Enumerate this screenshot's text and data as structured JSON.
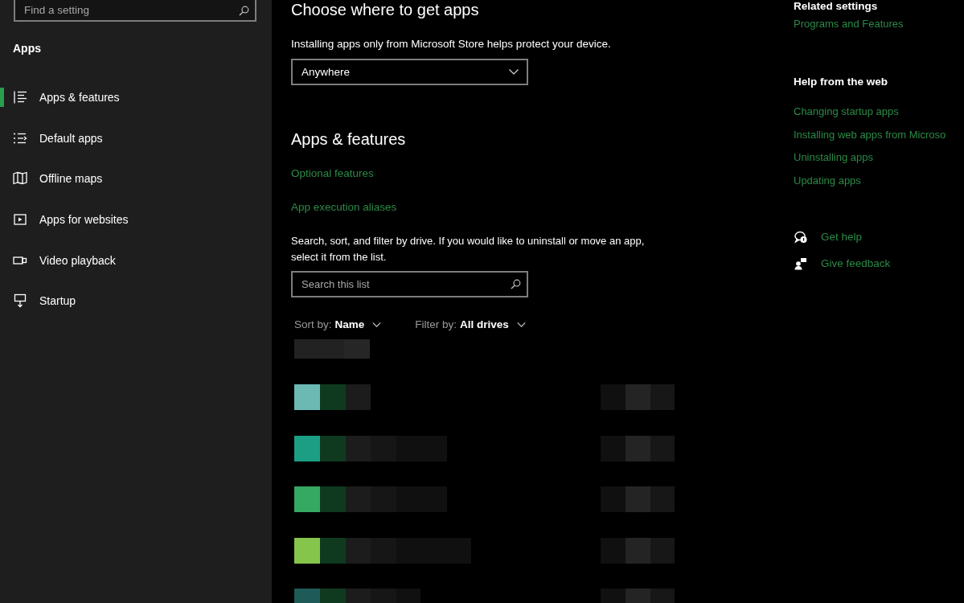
{
  "sidebar": {
    "search": {
      "placeholder": "Find a setting"
    },
    "section_title": "Apps",
    "items": [
      {
        "label": "Apps & features",
        "selected": true
      },
      {
        "label": "Default apps",
        "selected": false
      },
      {
        "label": "Offline maps",
        "selected": false
      },
      {
        "label": "Apps for websites",
        "selected": false
      },
      {
        "label": "Video playback",
        "selected": false
      },
      {
        "label": "Startup",
        "selected": false
      }
    ]
  },
  "main": {
    "choose_apps": {
      "title": "Choose where to get apps",
      "description": "Installing apps only from Microsoft Store helps protect your device.",
      "dropdown": {
        "value": "Anywhere"
      }
    },
    "apps_features": {
      "title": "Apps & features",
      "links": [
        "Optional features",
        "App execution aliases"
      ],
      "description": "Search, sort, and filter by drive. If you would like to uninstall or move an app, select it from the list.",
      "search": {
        "placeholder": "Search this list"
      },
      "sort": {
        "label": "Sort by:",
        "value": "Name"
      },
      "filter": {
        "label": "Filter by:",
        "value": "All drives"
      },
      "app_list": [
        {
          "color": "#6cb9b3"
        },
        {
          "color": "#1c9e84"
        },
        {
          "color": "#35a862"
        },
        {
          "color": "#86c54c"
        },
        {
          "color": "#1d5a58"
        }
      ]
    }
  },
  "side_panel": {
    "related_settings": {
      "title": "Related settings",
      "links": [
        "Programs and Features"
      ]
    },
    "help_from_web": {
      "title": "Help from the web",
      "links": [
        "Changing startup apps",
        "Installing web apps from Microso",
        "Uninstalling apps",
        "Updating apps"
      ]
    },
    "support_links": [
      "Get help",
      "Give feedback"
    ]
  }
}
